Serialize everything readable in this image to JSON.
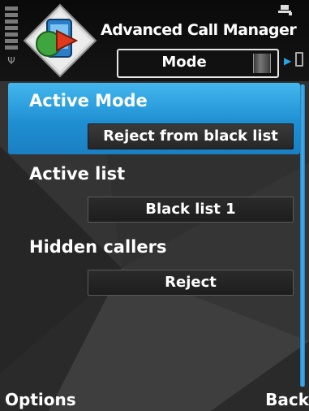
{
  "header": {
    "title": "Advanced Call Manager",
    "icons": [
      "signal-strength-icon",
      "antenna-icon",
      "app-icon",
      "battery-icon"
    ]
  },
  "tabs": {
    "active_label": "Mode",
    "next_icon": "chevron-right-icon"
  },
  "settings": [
    {
      "label": "Active Mode",
      "value": "Reject from black list",
      "selected": true
    },
    {
      "label": "Active list",
      "value": "Black list 1",
      "selected": false
    },
    {
      "label": "Hidden callers",
      "value": "Reject",
      "selected": false
    }
  ],
  "softkeys": {
    "left": "Options",
    "right": "Back"
  },
  "colors": {
    "accent": "#2aa3e6",
    "highlight": "#1f8fd2",
    "background": "#2b2b2b"
  }
}
